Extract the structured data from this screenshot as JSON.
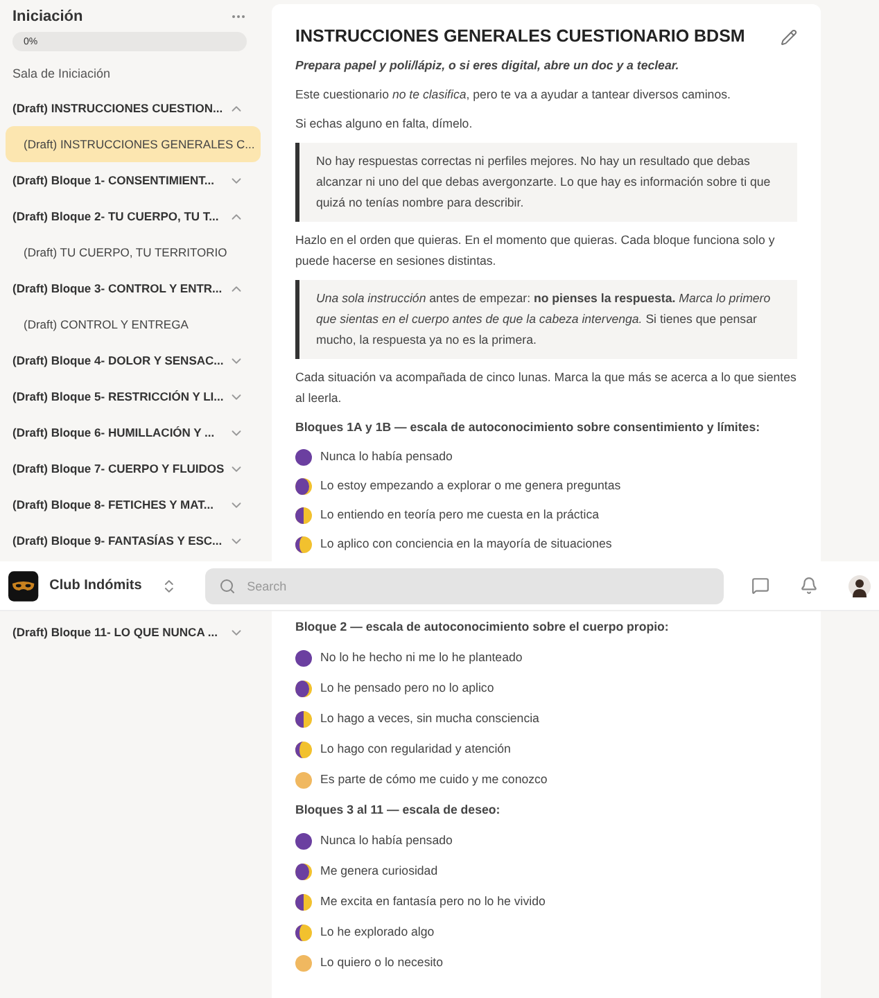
{
  "sidebar": {
    "title": "Iniciación",
    "progress": {
      "label": "0%",
      "level": 0
    },
    "room": "Sala de Iniciación",
    "items": [
      {
        "kind": "section",
        "label": "(Draft) INSTRUCCIONES CUESTION...",
        "expanded": true
      },
      {
        "kind": "page",
        "label": "(Draft) INSTRUCCIONES GENERALES C...",
        "selected": true
      },
      {
        "kind": "section",
        "label": "(Draft) Bloque 1- CONSENTIMIENT...",
        "expanded": false
      },
      {
        "kind": "section",
        "label": "(Draft) Bloque 2- TU CUERPO, TU T...",
        "expanded": true
      },
      {
        "kind": "page",
        "label": "(Draft) TU CUERPO, TU TERRITORIO",
        "selected": false
      },
      {
        "kind": "section",
        "label": "(Draft) Bloque 3- CONTROL Y ENTR...",
        "expanded": true
      },
      {
        "kind": "page",
        "label": "(Draft) CONTROL Y ENTREGA",
        "selected": false
      },
      {
        "kind": "section",
        "label": "(Draft) Bloque 4- DOLOR Y SENSAC...",
        "expanded": false
      },
      {
        "kind": "section",
        "label": "(Draft) Bloque 5- RESTRICCIÓN Y LI...",
        "expanded": false
      },
      {
        "kind": "section",
        "label": "(Draft) Bloque 6- HUMILLACIÓN Y ...",
        "expanded": false
      },
      {
        "kind": "section",
        "label": "(Draft) Bloque 7- CUERPO Y FLUIDOS",
        "expanded": false
      },
      {
        "kind": "section",
        "label": "(Draft) Bloque 8- FETICHES Y MAT...",
        "expanded": false
      },
      {
        "kind": "section",
        "label": "(Draft) Bloque 9- FANTASÍAS Y ESC...",
        "expanded": false
      }
    ]
  },
  "content": {
    "title": "INSTRUCCIONES GENERALES CUESTIONARIO BDSM",
    "blocks": [
      {
        "kind": "lead",
        "text": "Prepara papel y poli/lápiz, o si eres digital, abre un doc y a teclear."
      },
      {
        "kind": "paragraph",
        "text": "Este cuestionario *no te clasifica*, pero te va a ayudar a tantear diversos caminos."
      },
      {
        "kind": "paragraph",
        "text": "Si echas alguno en falta, dímelo."
      },
      {
        "kind": "quote",
        "text": "No hay respuestas correctas ni perfiles mejores. No hay un resultado que debas alcanzar ni uno del que debas avergonzarte. Lo que hay es información sobre ti que quizá no tenías nombre para describir."
      },
      {
        "kind": "paragraph",
        "text": "Hazlo en el orden que quieras. En el momento que quieras. Cada bloque funciona solo y puede hacerse en sesiones distintas."
      },
      {
        "kind": "quote",
        "text": "*Una sola instrucción* antes de empezar: **no pienses la respuesta.** *Marca lo primero que sientas en el cuerpo antes de que la cabeza intervenga.* Si tienes que pensar mucho, la respuesta ya no es la primera."
      },
      {
        "kind": "paragraph",
        "text": "Cada situación va acompañada de cinco lunas. Marca la que más se acerca a lo que sientes al leerla."
      },
      {
        "kind": "heading",
        "text": "Bloques 1A y 1B — escala de autoconocimiento sobre consentimiento y límites:"
      },
      {
        "kind": "new",
        "text": "Nunca lo había pensado"
      },
      {
        "kind": "crescent",
        "text": "Lo estoy empezando a explorar o me genera preguntas"
      },
      {
        "kind": "half",
        "text": "Lo entiendo en teoría pero me cuesta en la práctica"
      },
      {
        "kind": "gibbous",
        "text": "Lo aplico con conciencia en la mayoría de situaciones"
      }
    ]
  },
  "top_bar": {
    "workspace": "Club Indómits",
    "search": {
      "placeholder": "Search"
    }
  },
  "sidebar_lower": {
    "items": [
      {
        "kind": "section",
        "label": "(Draft) Bloque 11- LO QUE NUNCA ...",
        "expanded": false
      }
    ]
  },
  "content_lower": {
    "blocks": [
      {
        "kind": "heading",
        "text": "Bloque 2 — escala de autoconocimiento sobre el cuerpo propio:"
      },
      {
        "kind": "new",
        "text": "No lo he hecho ni me lo he planteado"
      },
      {
        "kind": "crescent",
        "text": "Lo he pensado pero no lo aplico"
      },
      {
        "kind": "half",
        "text": "Lo hago a veces, sin mucha consciencia"
      },
      {
        "kind": "gibbous",
        "text": "Lo hago con regularidad y atención"
      },
      {
        "kind": "full",
        "text": "Es parte de cómo me cuido y me conozco"
      },
      {
        "kind": "heading",
        "text": "Bloques 3 al 11 — escala de deseo:"
      },
      {
        "kind": "new",
        "text": "Nunca lo había pensado"
      },
      {
        "kind": "crescent",
        "text": "Me genera curiosidad"
      },
      {
        "kind": "half",
        "text": "Me excita en fantasía pero no lo he vivido"
      },
      {
        "kind": "gibbous",
        "text": "Lo he explorado algo"
      },
      {
        "kind": "full",
        "text": "Lo quiero o lo necesito"
      }
    ]
  }
}
